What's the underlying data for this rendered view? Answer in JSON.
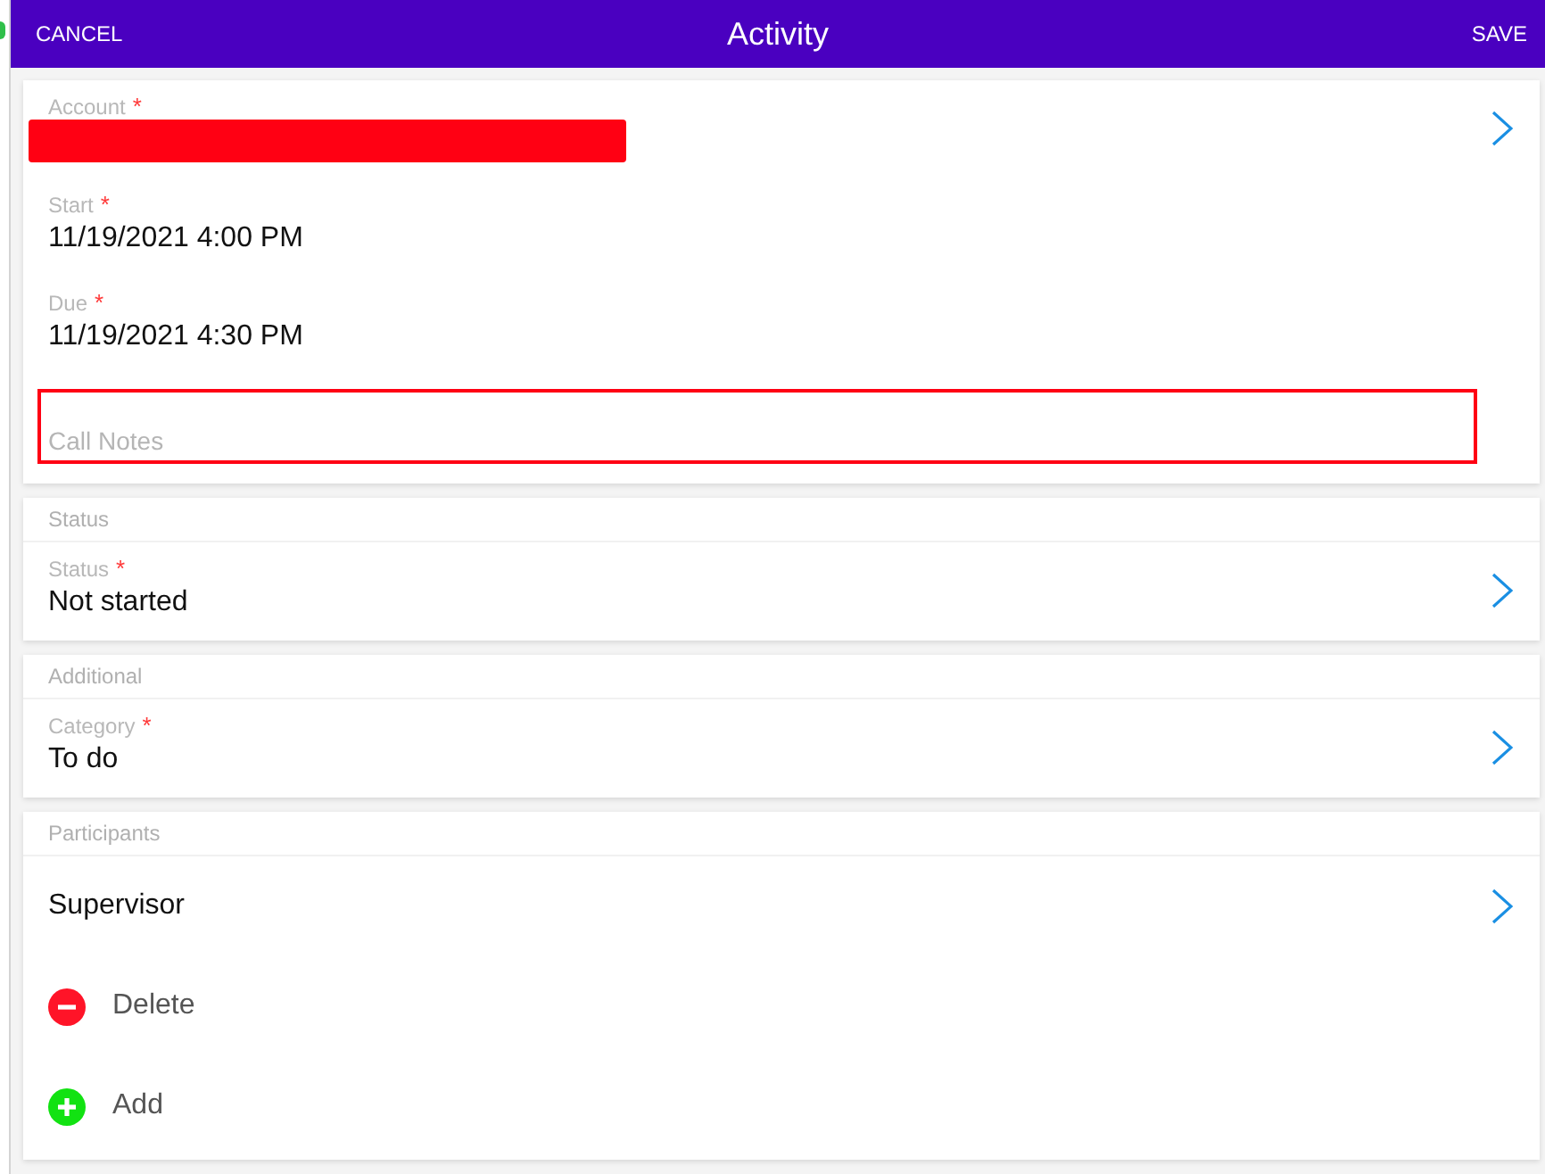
{
  "header": {
    "cancel": "CANCEL",
    "title": "Activity",
    "save": "SAVE"
  },
  "sections": [
    {
      "fields": [
        {
          "kind": "picker",
          "label": "Account",
          "required_mark": "*",
          "redacted": true
        },
        {
          "kind": "date",
          "label": "Start",
          "required_mark": "*",
          "value": "11/19/2021 4:00 PM"
        },
        {
          "kind": "date",
          "label": "Due",
          "required_mark": "*",
          "value": "11/19/2021 4:30 PM"
        },
        {
          "kind": "notes",
          "placeholder": "Call Notes",
          "highlighted": true
        }
      ]
    },
    {
      "heading": "Status",
      "fields": [
        {
          "kind": "picker",
          "label": "Status",
          "required_mark": "*",
          "value": "Not started"
        }
      ]
    },
    {
      "heading": "Additional",
      "fields": [
        {
          "kind": "picker",
          "label": "Category",
          "required_mark": "*",
          "value": "To do"
        }
      ]
    },
    {
      "heading": "Participants",
      "fields": [
        {
          "kind": "link",
          "value": "Supervisor"
        },
        {
          "kind": "remove",
          "label": "Delete"
        },
        {
          "kind": "add",
          "label": "Add"
        }
      ]
    }
  ]
}
